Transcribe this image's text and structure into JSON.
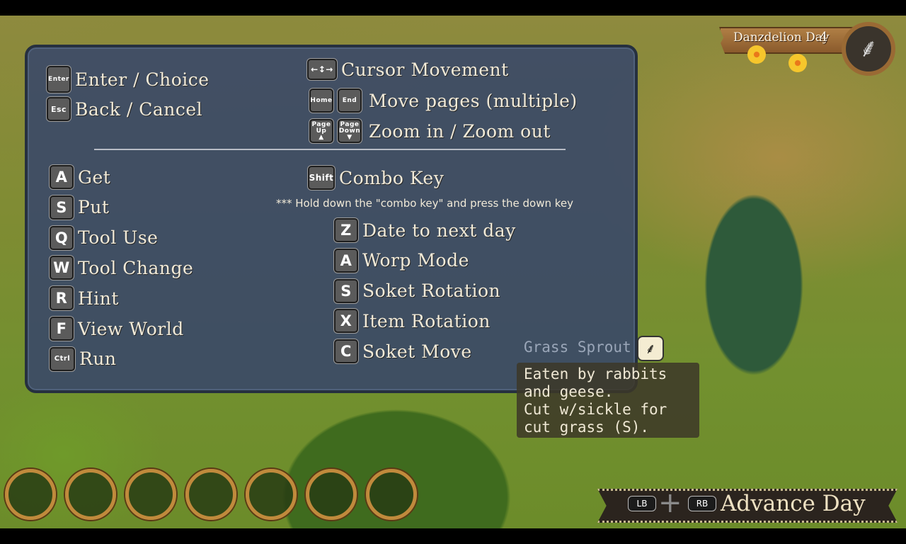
{
  "hud": {
    "date_label": "Danzdelion Day",
    "day_number": "4",
    "equipped_tool_icon": "sickle-icon"
  },
  "controls": {
    "system": [
      {
        "key": "Enter",
        "label": "Enter / Choice"
      },
      {
        "key": "Esc",
        "label": "Back / Cancel"
      }
    ],
    "navigation": [
      {
        "keys": [
          "arrows"
        ],
        "label": "Cursor Movement"
      },
      {
        "keys": [
          "Home",
          "End"
        ],
        "label": "Move pages (multiple)"
      },
      {
        "keys": [
          "Page Up",
          "Page Down"
        ],
        "label": "Zoom in / Zoom out"
      }
    ],
    "actions": [
      {
        "key": "A",
        "label": "Get"
      },
      {
        "key": "S",
        "label": "Put"
      },
      {
        "key": "Q",
        "label": "Tool Use"
      },
      {
        "key": "W",
        "label": "Tool Change"
      },
      {
        "key": "R",
        "label": "Hint"
      },
      {
        "key": "F",
        "label": "View World"
      },
      {
        "key": "Ctrl",
        "label": "Run"
      }
    ],
    "combo": {
      "key": "Shift",
      "label": "Combo Key",
      "note": "*** Hold down the \"combo key\" and press the down key"
    },
    "combo_actions": [
      {
        "key": "Z",
        "label": "Date to next day"
      },
      {
        "key": "A",
        "label": "Worp Mode"
      },
      {
        "key": "S",
        "label": "Soket Rotation"
      },
      {
        "key": "X",
        "label": "Item Rotation"
      },
      {
        "key": "C",
        "label": "Soket Move"
      }
    ]
  },
  "tooltip": {
    "title": "Grass Sprout",
    "icon": "sickle-icon",
    "description": "Eaten by rabbits and geese.\nCut w/sickle for cut grass (S)."
  },
  "hotbar": {
    "slots": 7
  },
  "advance_day": {
    "left_button": "LB",
    "right_button": "RB",
    "label": "Advance Day"
  }
}
